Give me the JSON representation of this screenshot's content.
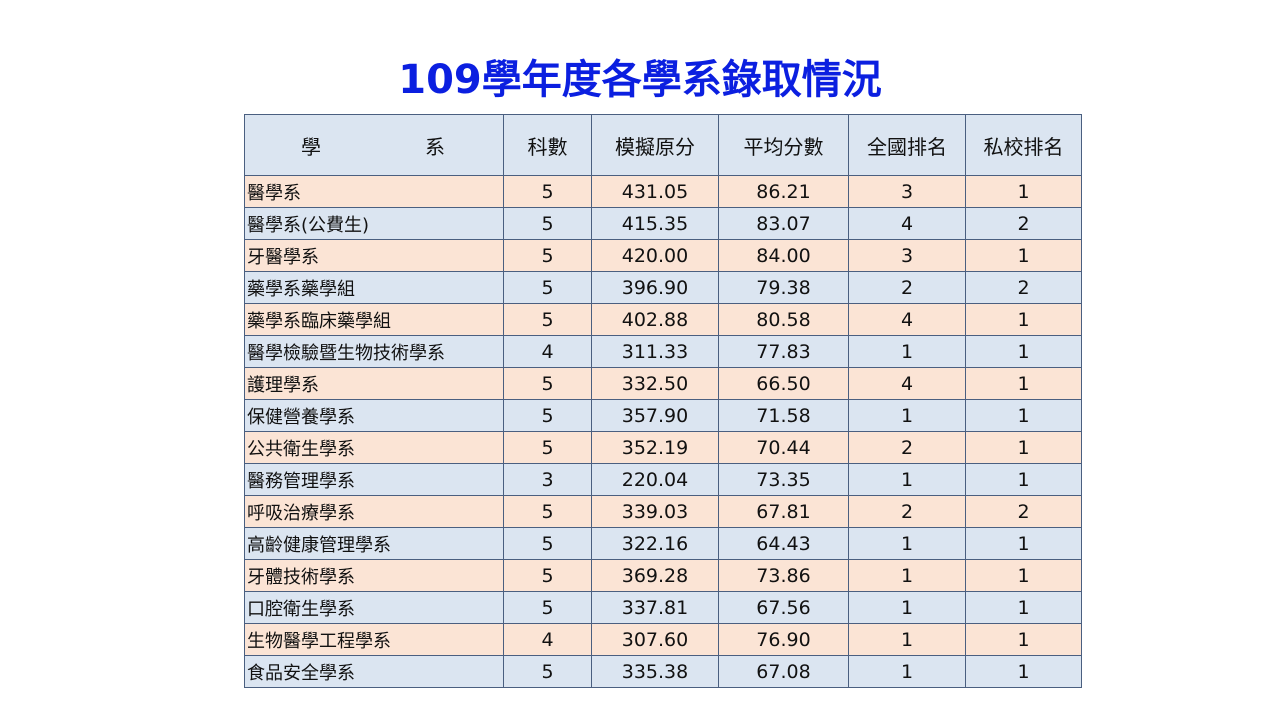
{
  "title": "109學年度各學系錄取情況",
  "table": {
    "headers": {
      "dept_left": "學",
      "dept_right": "系",
      "subjects": "科數",
      "raw_score": "模擬原分",
      "avg_score": "平均分數",
      "national_rank": "全國排名",
      "private_rank": "私校排名"
    },
    "rows": [
      {
        "dept": "醫學系",
        "subjects": "5",
        "raw": "431.05",
        "avg": "86.21",
        "national": "3",
        "private": "1"
      },
      {
        "dept": "醫學系(公費生)",
        "subjects": "5",
        "raw": "415.35",
        "avg": "83.07",
        "national": "4",
        "private": "2"
      },
      {
        "dept": "牙醫學系",
        "subjects": "5",
        "raw": "420.00",
        "avg": "84.00",
        "national": "3",
        "private": "1"
      },
      {
        "dept": "藥學系藥學組",
        "subjects": "5",
        "raw": "396.90",
        "avg": "79.38",
        "national": "2",
        "private": "2"
      },
      {
        "dept": "藥學系臨床藥學組",
        "subjects": "5",
        "raw": "402.88",
        "avg": "80.58",
        "national": "4",
        "private": "1"
      },
      {
        "dept": "醫學檢驗暨生物技術學系",
        "subjects": "4",
        "raw": "311.33",
        "avg": "77.83",
        "national": "1",
        "private": "1"
      },
      {
        "dept": "護理學系",
        "subjects": "5",
        "raw": "332.50",
        "avg": "66.50",
        "national": "4",
        "private": "1"
      },
      {
        "dept": "保健營養學系",
        "subjects": "5",
        "raw": "357.90",
        "avg": "71.58",
        "national": "1",
        "private": "1"
      },
      {
        "dept": "公共衛生學系",
        "subjects": "5",
        "raw": "352.19",
        "avg": "70.44",
        "national": "2",
        "private": "1"
      },
      {
        "dept": "醫務管理學系",
        "subjects": "3",
        "raw": "220.04",
        "avg": "73.35",
        "national": "1",
        "private": "1"
      },
      {
        "dept": "呼吸治療學系",
        "subjects": "5",
        "raw": "339.03",
        "avg": "67.81",
        "national": "2",
        "private": "2"
      },
      {
        "dept": "高齡健康管理學系",
        "subjects": "5",
        "raw": "322.16",
        "avg": "64.43",
        "national": "1",
        "private": "1"
      },
      {
        "dept": "牙體技術學系",
        "subjects": "5",
        "raw": "369.28",
        "avg": "73.86",
        "national": "1",
        "private": "1"
      },
      {
        "dept": "口腔衛生學系",
        "subjects": "5",
        "raw": "337.81",
        "avg": "67.56",
        "national": "1",
        "private": "1"
      },
      {
        "dept": "生物醫學工程學系",
        "subjects": "4",
        "raw": "307.60",
        "avg": "76.90",
        "national": "1",
        "private": "1"
      },
      {
        "dept": "食品安全學系",
        "subjects": "5",
        "raw": "335.38",
        "avg": "67.08",
        "national": "1",
        "private": "1"
      }
    ]
  },
  "colors": {
    "title": "#0b1fe0",
    "header_bg": "#dbe5f1",
    "row_odd_bg": "#fbe4d5",
    "row_even_bg": "#dbe5f1",
    "border": "#4a5f80"
  }
}
